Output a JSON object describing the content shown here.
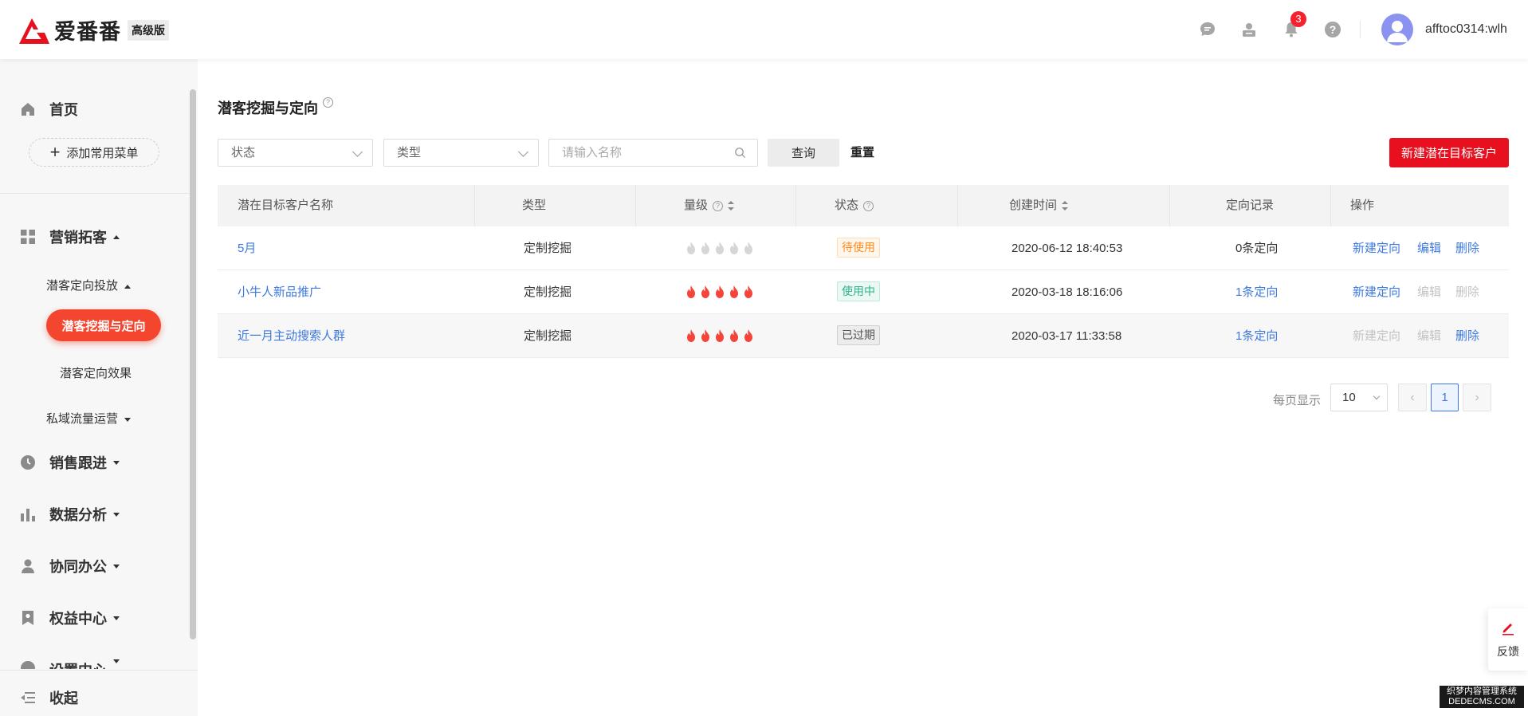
{
  "header": {
    "brand": "爱番番",
    "edition_badge": "高级版",
    "notification_count": "3",
    "username": "afftoc0314:wlh",
    "icons": [
      "chat-icon",
      "contact-icon",
      "bell-icon",
      "help-icon"
    ]
  },
  "sidebar": {
    "home": "首页",
    "add_menu": "添加常用菜单",
    "marketing": "营销拓客",
    "sub_targeting": "潜客定向投放",
    "active_item": "潜客挖掘与定向",
    "targeting_effect": "潜客定向效果",
    "private_traffic": "私域流量运营",
    "sales": "销售跟进",
    "data_analysis": "数据分析",
    "collaboration": "协同办公",
    "benefits": "权益中心",
    "settings": "设置中心",
    "collapse": "收起"
  },
  "page": {
    "title": "潜客挖掘与定向"
  },
  "filters": {
    "status_placeholder": "状态",
    "type_placeholder": "类型",
    "name_placeholder": "请输入名称",
    "query_label": "查询",
    "reset_label": "重置",
    "new_button": "新建潜在目标客户"
  },
  "table": {
    "columns": {
      "name": "潜在目标客户名称",
      "type": "类型",
      "level": "量级",
      "status": "状态",
      "created": "创建时间",
      "record": "定向记录",
      "actions": "操作"
    },
    "rows": [
      {
        "name": "5月",
        "type": "定制挖掘",
        "level": 0,
        "status": "待使用",
        "created": "2020-06-12 18:40:53",
        "record": "0条定向",
        "action_new": "新建定向",
        "action_edit": "编辑",
        "action_delete": "删除"
      },
      {
        "name": "小牛人新品推广",
        "type": "定制挖掘",
        "level": 5,
        "status": "使用中",
        "created": "2020-03-18 18:16:06",
        "record": "1条定向",
        "action_new": "新建定向",
        "action_edit": "编辑",
        "action_delete": "删除"
      },
      {
        "name": "近一月主动搜索人群",
        "type": "定制挖掘",
        "level": 5,
        "status": "已过期",
        "created": "2020-03-17 11:33:58",
        "record": "1条定向",
        "action_new": "新建定向",
        "action_edit": "编辑",
        "action_delete": "删除"
      }
    ]
  },
  "pagination": {
    "per_page_label": "每页显示",
    "per_page_value": "10",
    "current_page": "1",
    "prev_icon": "‹",
    "next_icon": "›"
  },
  "feedback": {
    "label": "反馈"
  },
  "watermark": {
    "line1": "织梦内容管理系统",
    "line2": "DEDECMS.COM"
  },
  "colors": {
    "brand_red": "#e8101f",
    "active_pill": "#f4452f",
    "link_blue": "#3e79e0",
    "flame_active": "#f5453a",
    "flame_inactive": "#d6d6d6"
  }
}
